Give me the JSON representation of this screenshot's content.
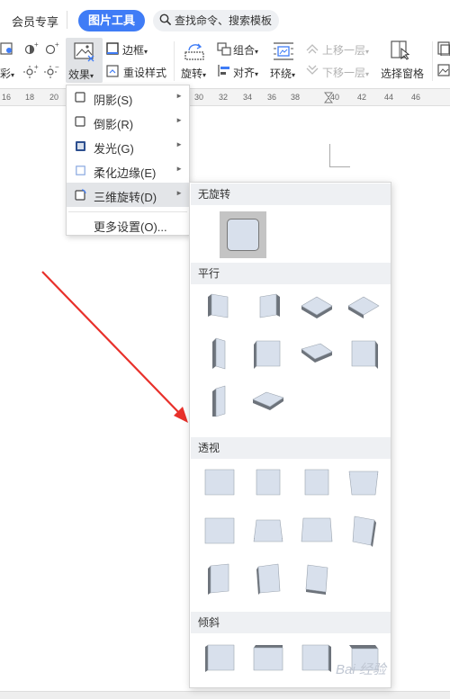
{
  "tabs": {
    "member": "会员专享",
    "picture_tools": "图片工具",
    "search": "查找命令、搜索模板"
  },
  "toolbar": {
    "color_partial": "彩",
    "effects": "效果",
    "border": "边框",
    "reset_style": "重设样式",
    "rotate": "旋转",
    "group": "组合",
    "align": "对齐",
    "wrap": "环绕",
    "bring_forward": "上移一层",
    "send_backward": "下移一层",
    "selection_pane": "选择窗格"
  },
  "ruler": {
    "marks": [
      "16",
      "18",
      "20",
      "30",
      "32",
      "34",
      "36",
      "38",
      "40",
      "42",
      "44",
      "46"
    ]
  },
  "effects_menu": {
    "items": [
      {
        "label": "阴影(S)",
        "icon": "shadow-icon"
      },
      {
        "label": "倒影(R)",
        "icon": "reflection-icon"
      },
      {
        "label": "发光(G)",
        "icon": "glow-icon"
      },
      {
        "label": "柔化边缘(E)",
        "icon": "soft-edge-icon"
      },
      {
        "label": "三维旋转(D)",
        "icon": "3d-rotation-icon"
      }
    ],
    "more": "更多设置(O)..."
  },
  "rotation_menu": {
    "sections": {
      "no_rotation": "无旋转",
      "parallel": "平行",
      "perspective": "透视",
      "oblique": "倾斜"
    }
  },
  "watermark": "Bai 经验",
  "colors": {
    "accent": "#3f7cf6",
    "arrow": "#e8302a",
    "tile_face": "#d8e0ec",
    "tile_edge": "#6d737b"
  }
}
